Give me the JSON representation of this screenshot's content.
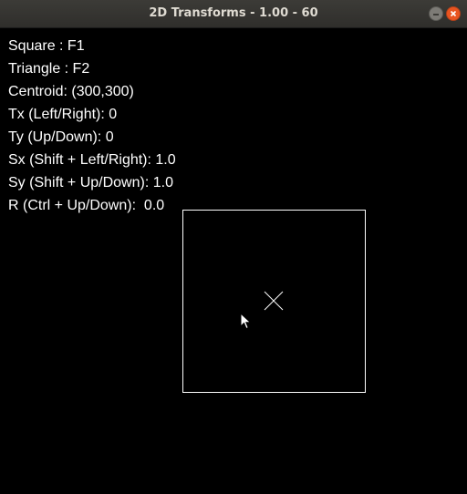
{
  "window": {
    "title": "2D Transforms - 1.00 - 60"
  },
  "hud": {
    "square": "Square : F1",
    "triangle": "Triangle : F2",
    "centroid": "Centroid: (300,300)",
    "tx": "Tx (Left/Right): 0",
    "ty": "Ty (Up/Down): 0",
    "sx": "Sx (Shift + Left/Right): 1.0",
    "sy": "Sy (Shift + Up/Down): 1.0",
    "r": "R (Ctrl + Up/Down):  0.0"
  },
  "colors": {
    "background": "#000000",
    "foreground": "#ffffff",
    "close_button": "#e95420"
  },
  "icons": {
    "minimize": "minimize-icon",
    "close": "close-icon",
    "centroid": "centroid-cross-icon",
    "cursor": "mouse-cursor-icon"
  }
}
